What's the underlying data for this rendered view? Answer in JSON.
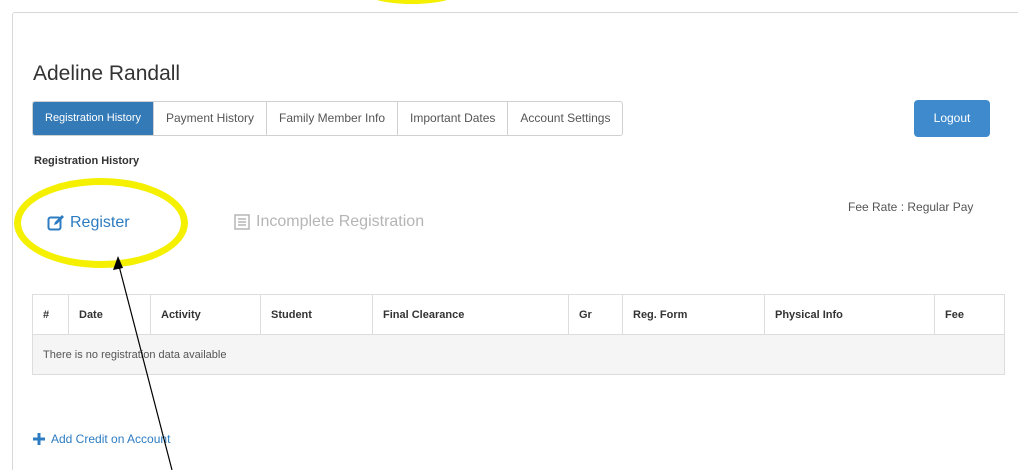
{
  "user": {
    "name": "Adeline Randall"
  },
  "tabs": [
    {
      "label": "Registration History",
      "active": true
    },
    {
      "label": "Payment History",
      "active": false
    },
    {
      "label": "Family Member Info",
      "active": false
    },
    {
      "label": "Important Dates",
      "active": false
    },
    {
      "label": "Account Settings",
      "active": false
    }
  ],
  "logout_label": "Logout",
  "section_title": "Registration History",
  "actions": {
    "register_label": "Register",
    "incomplete_label": "Incomplete Registration"
  },
  "fee_rate": "Fee Rate : Regular Pay",
  "table": {
    "headers": [
      "#",
      "Date",
      "Activity",
      "Student",
      "Final Clearance",
      "Gr",
      "Reg. Form",
      "Physical Info",
      "Fee"
    ],
    "empty_message": "There is no registration data available"
  },
  "add_credit_label": "Add Credit on Account",
  "colors": {
    "primary": "#337ab7",
    "link": "#2d7cc1",
    "highlight": "#f4f000"
  },
  "icons": {
    "register": "edit-icon",
    "incomplete": "list-icon",
    "add_credit": "plus-icon"
  }
}
